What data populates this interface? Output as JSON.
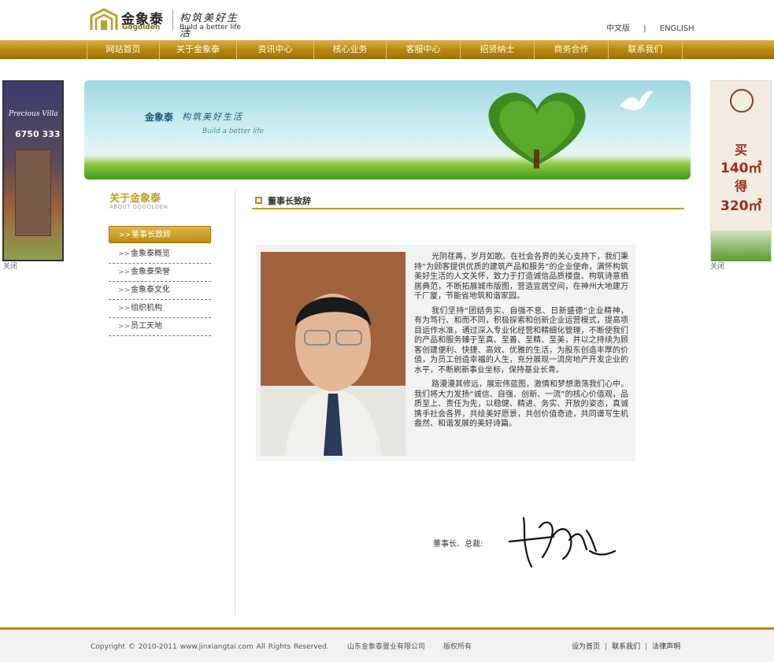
{
  "brand": {
    "name_cn": "金象泰",
    "name_en": "Gogolden",
    "slogan_cn": "构筑美好生活",
    "slogan_en": "Build a better life"
  },
  "lang": {
    "cn": "中文版",
    "divider": "|",
    "en": "ENGLISH"
  },
  "nav": [
    "网站首页",
    "关于金象泰",
    "资讯中心",
    "核心业务",
    "客服中心",
    "招贤纳士",
    "商务合作",
    "联系我们"
  ],
  "ads": {
    "left": {
      "title": "Precious Villa",
      "phone": "6750 333",
      "close": "关闭"
    },
    "right": {
      "line1": "买",
      "line2": "140㎡",
      "line3": "得",
      "line4": "320㎡",
      "close": "关闭"
    }
  },
  "banner": {
    "cn": "金象泰",
    "slogan": "构筑美好生活",
    "en": "Build a better life"
  },
  "sidebar": {
    "title": "关于金象泰",
    "subtitle": "ABOUT GOGOLDEN",
    "items": [
      "董事长致辞",
      "金象泰概览",
      "金象泰荣誉",
      "金象泰文化",
      "组织机构",
      "员工天地"
    ]
  },
  "main": {
    "title": "董事长致辞",
    "paragraphs": [
      "光阴荏苒，岁月如歌。在社会各界的关心支持下，我们秉持“为顾客提供优质的建筑产品和服务”的企业使命，满怀构筑美好生活的人文关怀，致力于打造诚信品质楼盘、构筑诗意栖居典范，不断拓展城市版图，营造宜居空间，在神州大地建万千厂厦，节能省地筑和谐家园。",
      "我们坚持“团结务实、自强不息、日新盛德”企业精神，有为笃行、和而不同，积极探索和创新企业运营模式，提高项目运作水准，通过深入专业化经营和精细化管理，不断使我们的产品和服务臻于至真、至善、至精、至美，并以之持续为顾客创建便利、快捷、高效、优雅的生活，为股东创造丰厚的价值，为员工创造幸福的人生，充分展现一流房地产开发企业的水平，不断刷新事业坐标，保持基业长青。",
      "路漫漫其修远，展宏伟蓝图，激情和梦想激荡我们心中。我们将大力发扬“诚信、自强、创新、一流”的核心价值观，品质至上、责任为先，以稳健、精进、务实、开放的姿态，真诚携手社会各界，共绘美好愿景，共创价值奇迹，共同谱写生机盎然、和谐发展的美好诗篇。"
    ],
    "signature_label": "董事长、总裁:"
  },
  "footer": {
    "copyright": "Copyright © 2010-2011 www.jinxiangtai.com All Rights Reserved.      山东金象泰置业有限公司      版权所有",
    "links": [
      "设为首页",
      "联系我们",
      "法律声明"
    ]
  }
}
